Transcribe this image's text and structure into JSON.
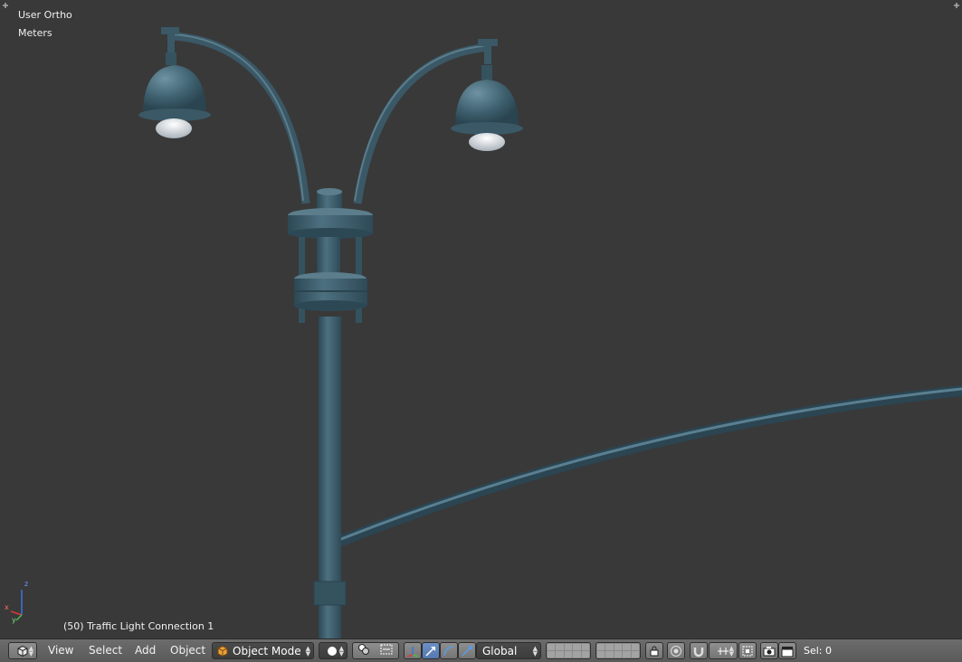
{
  "viewport": {
    "view_name": "User Ortho",
    "units": "Meters",
    "object_info": "(50) Traffic Light Connection 1",
    "axis_labels": {
      "z": "z",
      "x": "x",
      "y": "y"
    }
  },
  "colors": {
    "background": "#393939",
    "model": "#3a5866",
    "model_light": "#5b7d8c",
    "bulb": "#e6e9ec"
  },
  "header": {
    "editor_type_icon": "3d-view-icon",
    "menus": [
      "View",
      "Select",
      "Add",
      "Object"
    ],
    "mode": "Object Mode",
    "pivot_icon": "pivot-point-icon",
    "transform_orientation": "Global",
    "status": "Sel: 0"
  }
}
